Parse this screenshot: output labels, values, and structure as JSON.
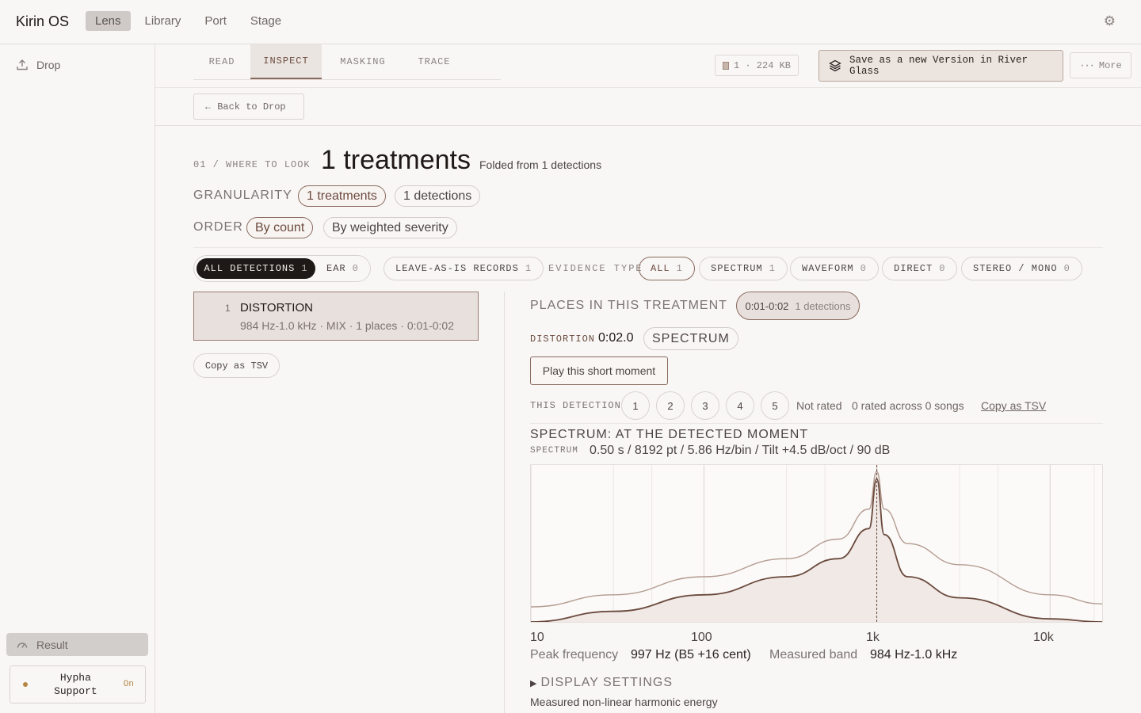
{
  "app": {
    "brand": "Kirin OS",
    "nav": [
      "Lens",
      "Library",
      "Port",
      "Stage"
    ],
    "active_nav": "Lens",
    "settings_icon": "gear-icon"
  },
  "sidebar": {
    "drop_label": "Drop",
    "result_label": "Result",
    "hypha_label": "Hypha Support",
    "hypha_status": "On"
  },
  "tabs": [
    "READ",
    "INSPECT",
    "MASKING",
    "TRACE"
  ],
  "active_tab": "INSPECT",
  "toolbar": {
    "size_chip": "1 · 224 KB",
    "save_label": "Save as a new Version in River Glass",
    "more_label": "More",
    "back_label": "Back to Drop"
  },
  "heading": {
    "kicker": "01 / WHERE TO LOOK",
    "title": "1 treatments",
    "subtitle": "Folded from 1 detections"
  },
  "granularity": {
    "label": "GRANULARITY",
    "options": [
      "1 treatments",
      "1 detections"
    ],
    "selected": "1 treatments"
  },
  "order": {
    "label": "ORDER",
    "options": [
      "By count",
      "By weighted severity"
    ],
    "selected": "By count"
  },
  "filters": {
    "segment": [
      {
        "label": "ALL DETECTIONS",
        "count": "1"
      },
      {
        "label": "EAR",
        "count": "0"
      }
    ],
    "leave_as_is": {
      "label": "LEAVE-AS-IS RECORDS",
      "count": "1"
    },
    "evidence_label": "EVIDENCE TYPE",
    "evidence": [
      {
        "label": "ALL",
        "count": "1"
      },
      {
        "label": "SPECTRUM",
        "count": "1"
      },
      {
        "label": "WAVEFORM",
        "count": "0"
      },
      {
        "label": "DIRECT",
        "count": "0"
      },
      {
        "label": "STEREO / MONO",
        "count": "0"
      }
    ]
  },
  "detections": [
    {
      "num": "1",
      "title": "DISTORTION",
      "meta": "984 Hz-1.0 kHz · MIX · 1 places · 0:01-0:02"
    }
  ],
  "copy_tsv_left": "Copy as TSV",
  "treatment": {
    "places_title": "PLACES IN THIS TREATMENT",
    "place_range": "0:01-0:02",
    "place_count": "1 detections",
    "dist_tag": "DISTORTION",
    "dist_time": "0:02.0",
    "spec_pill": "SPECTRUM",
    "play_label": "Play this short moment",
    "this_detection": "THIS DETECTION",
    "ratings": [
      "1",
      "2",
      "3",
      "4",
      "5"
    ],
    "not_rated": "Not rated",
    "rated_across": "0 rated across 0 songs",
    "copy_tsv": "Copy as TSV",
    "spectrum_title": "SPECTRUM: AT THE DETECTED MOMENT",
    "spectrum_tag": "SPECTRUM",
    "spectrum_params": "0.50 s / 8192 pt / 5.86 Hz/bin / Tilt +4.5 dB/oct / 90 dB",
    "peak_label": "Peak frequency",
    "peak_value": "997 Hz (B5 +16 cent)",
    "band_label": "Measured band",
    "band_value": "984 Hz-1.0 kHz",
    "display_settings": "DISPLAY SETTINGS",
    "footnote": "Measured non-linear harmonic energy"
  },
  "chart_data": {
    "type": "line",
    "xscale": "log",
    "xlim": [
      10,
      20000
    ],
    "xticks": [
      "10",
      "100",
      "1k",
      "10k"
    ],
    "peak_hz": 997,
    "series": [
      {
        "x": [
          10,
          30,
          100,
          300,
          600,
          900,
          997,
          1100,
          1500,
          3000,
          10000,
          20000
        ],
        "values": [
          0.1,
          0.18,
          0.3,
          0.42,
          0.55,
          0.75,
          1.0,
          0.75,
          0.52,
          0.38,
          0.18,
          0.12
        ]
      },
      {
        "x": [
          10,
          30,
          100,
          300,
          600,
          900,
          997,
          1100,
          1500,
          3000,
          10000,
          20000
        ],
        "values": [
          0.0,
          0.07,
          0.18,
          0.3,
          0.42,
          0.62,
          0.95,
          0.58,
          0.3,
          0.16,
          0.02,
          0.0
        ]
      }
    ]
  },
  "colors": {
    "accent": "#8a6a5e",
    "accent_fill": "#e8e0dc",
    "dark": "#1e1816",
    "dot": "#b58746"
  }
}
